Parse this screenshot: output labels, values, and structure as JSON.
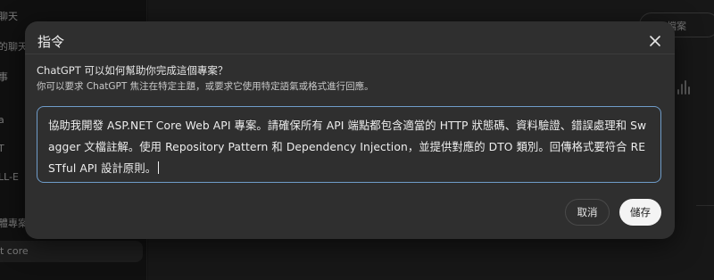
{
  "background": {
    "sidebar_items": [
      "聊天",
      "的聊天",
      "事",
      "a",
      "T",
      "LL-E",
      "體專案",
      "t core"
    ],
    "top_pill_label": "檔案"
  },
  "modal": {
    "title": "指令",
    "close_icon": "close-icon",
    "question": "ChatGPT 可以如何幫助你完成這個專案？",
    "hint": "你可以要求 ChatGPT 焦注在特定主題，或要求它使用特定語氣或格式進行回應。",
    "prompt_value": "協助我開發 ASP.NET Core Web API 專案。請確保所有 API 端點都包含適當的 HTTP 狀態碼、資料驗證、錯誤處理和 Swagger 文檔註解。使用 Repository Pattern 和 Dependency Injection，並提供對應的 DTO 類別。回傳格式要符合 RESTful API 設計原則。",
    "cancel_label": "取消",
    "save_label": "儲存"
  },
  "colors": {
    "modal_bg": "#2f2f2f",
    "input_focus_border": "#6f9cc9",
    "save_button_bg": "#f4f4f4"
  }
}
